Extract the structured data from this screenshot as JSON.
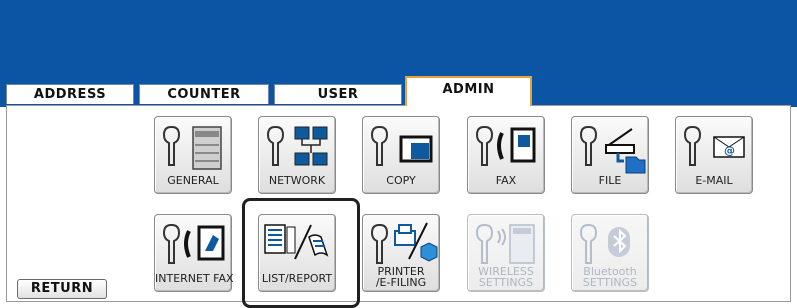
{
  "tabs": [
    {
      "label": "ADDRESS",
      "active": false
    },
    {
      "label": "COUNTER",
      "active": false
    },
    {
      "label": "USER",
      "active": false
    },
    {
      "label": "ADMIN",
      "active": true
    }
  ],
  "buttons_row1": [
    {
      "label": "GENERAL",
      "icon": "printer-icon"
    },
    {
      "label": "NETWORK",
      "icon": "network-icon"
    },
    {
      "label": "COPY",
      "icon": "copy-icon"
    },
    {
      "label": "FAX",
      "icon": "fax-icon"
    },
    {
      "label": "FILE",
      "icon": "folder-icon"
    },
    {
      "label": "E-MAIL",
      "icon": "email-icon"
    }
  ],
  "buttons_row2": [
    {
      "label": "INTERNET FAX",
      "icon": "internet-fax-icon",
      "enabled": true
    },
    {
      "label": "LIST/REPORT",
      "icon": "list-report-icon",
      "enabled": true,
      "selected": true
    },
    {
      "label_line1": "PRINTER",
      "label_line2": "/E-FILING",
      "icon": "printer-efiling-icon",
      "enabled": true
    },
    {
      "label_line1": "WIRELESS",
      "label_line2": "SETTINGS",
      "icon": "wireless-icon",
      "enabled": false
    },
    {
      "label_line1": "Bluetooth",
      "label_line2": "SETTINGS",
      "icon": "bluetooth-icon",
      "enabled": false
    }
  ],
  "return_label": "RETURN",
  "colors": {
    "header": "#0c55a4",
    "active_tab_border": "#e9a23a",
    "disabled_text": "#aeb6c4"
  }
}
